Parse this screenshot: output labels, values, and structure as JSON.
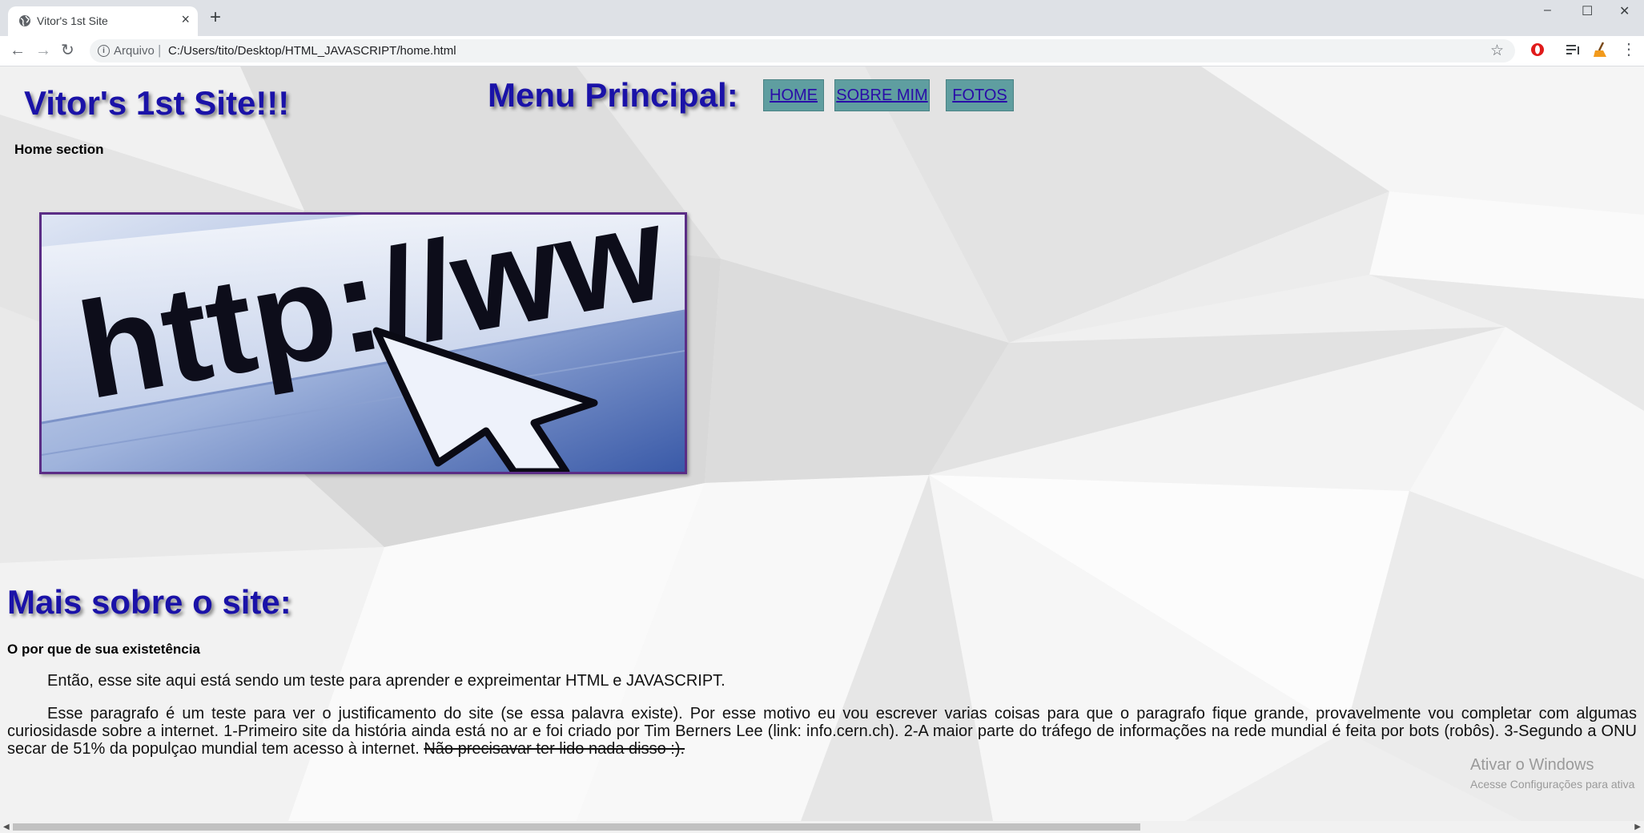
{
  "browser": {
    "tab_title": "Vitor's 1st Site",
    "tab_close": "×",
    "new_tab": "+",
    "window_controls": {
      "minimize": "–",
      "maximize": "☐",
      "close": "✕"
    },
    "nav": {
      "back": "←",
      "forward": "→",
      "reload": "↻"
    },
    "address": {
      "scheme_label": "Arquivo",
      "separator": "|",
      "url": "C:/Users/tito/Desktop/HTML_JAVASCRIPT/home.html",
      "star": "☆"
    },
    "menu_dots": "⋮"
  },
  "page": {
    "site_title": "Vitor's 1st Site!!!",
    "menu_title": "Menu Principal:",
    "menu_items": [
      {
        "label": "HOME"
      },
      {
        "label": "SOBRE MIM"
      },
      {
        "label": "FOTOS"
      }
    ],
    "section_label": "Home section",
    "hero_text": "http://ww",
    "more_heading": "Mais sobre o site:",
    "why_heading": "O por que de sua existetência",
    "paragraph_1": "Então, esse site aqui está sendo um teste para aprender e expreimentar HTML e JAVASCRIPT.",
    "paragraph_2": "Esse paragrafo é um teste para ver o justificamento do site (se essa palavra existe). Por esse motivo eu vou escrever varias coisas para que o paragrafo fique grande, provavelmente vou completar com algumas curiosidasde sobre a internet. 1-Primeiro site da história ainda está no ar e foi criado por Tim Berners Lee (link: info.cern.ch). 2-A maior parte do tráfego de informações na rede mundial é feita por bots (robôs). 3-Segundo a ONU secar de 51% da populçao mundial tem acesso à internet.",
    "paragraph_2_strike": "Não precisavar ter lido nada disso :)."
  },
  "watermark": {
    "line1": "Ativar o Windows",
    "line2": "Acesse Configurações para ativa"
  },
  "colors": {
    "heading": "#1a12a8",
    "menu_button_bg": "#5f9ea0",
    "link": "#2a0ca8",
    "hero_border": "#5b2d86"
  },
  "icons": [
    "globe-icon",
    "info-icon",
    "star-icon",
    "opera-icon",
    "reading-list-icon",
    "broom-icon",
    "menu-icon"
  ]
}
